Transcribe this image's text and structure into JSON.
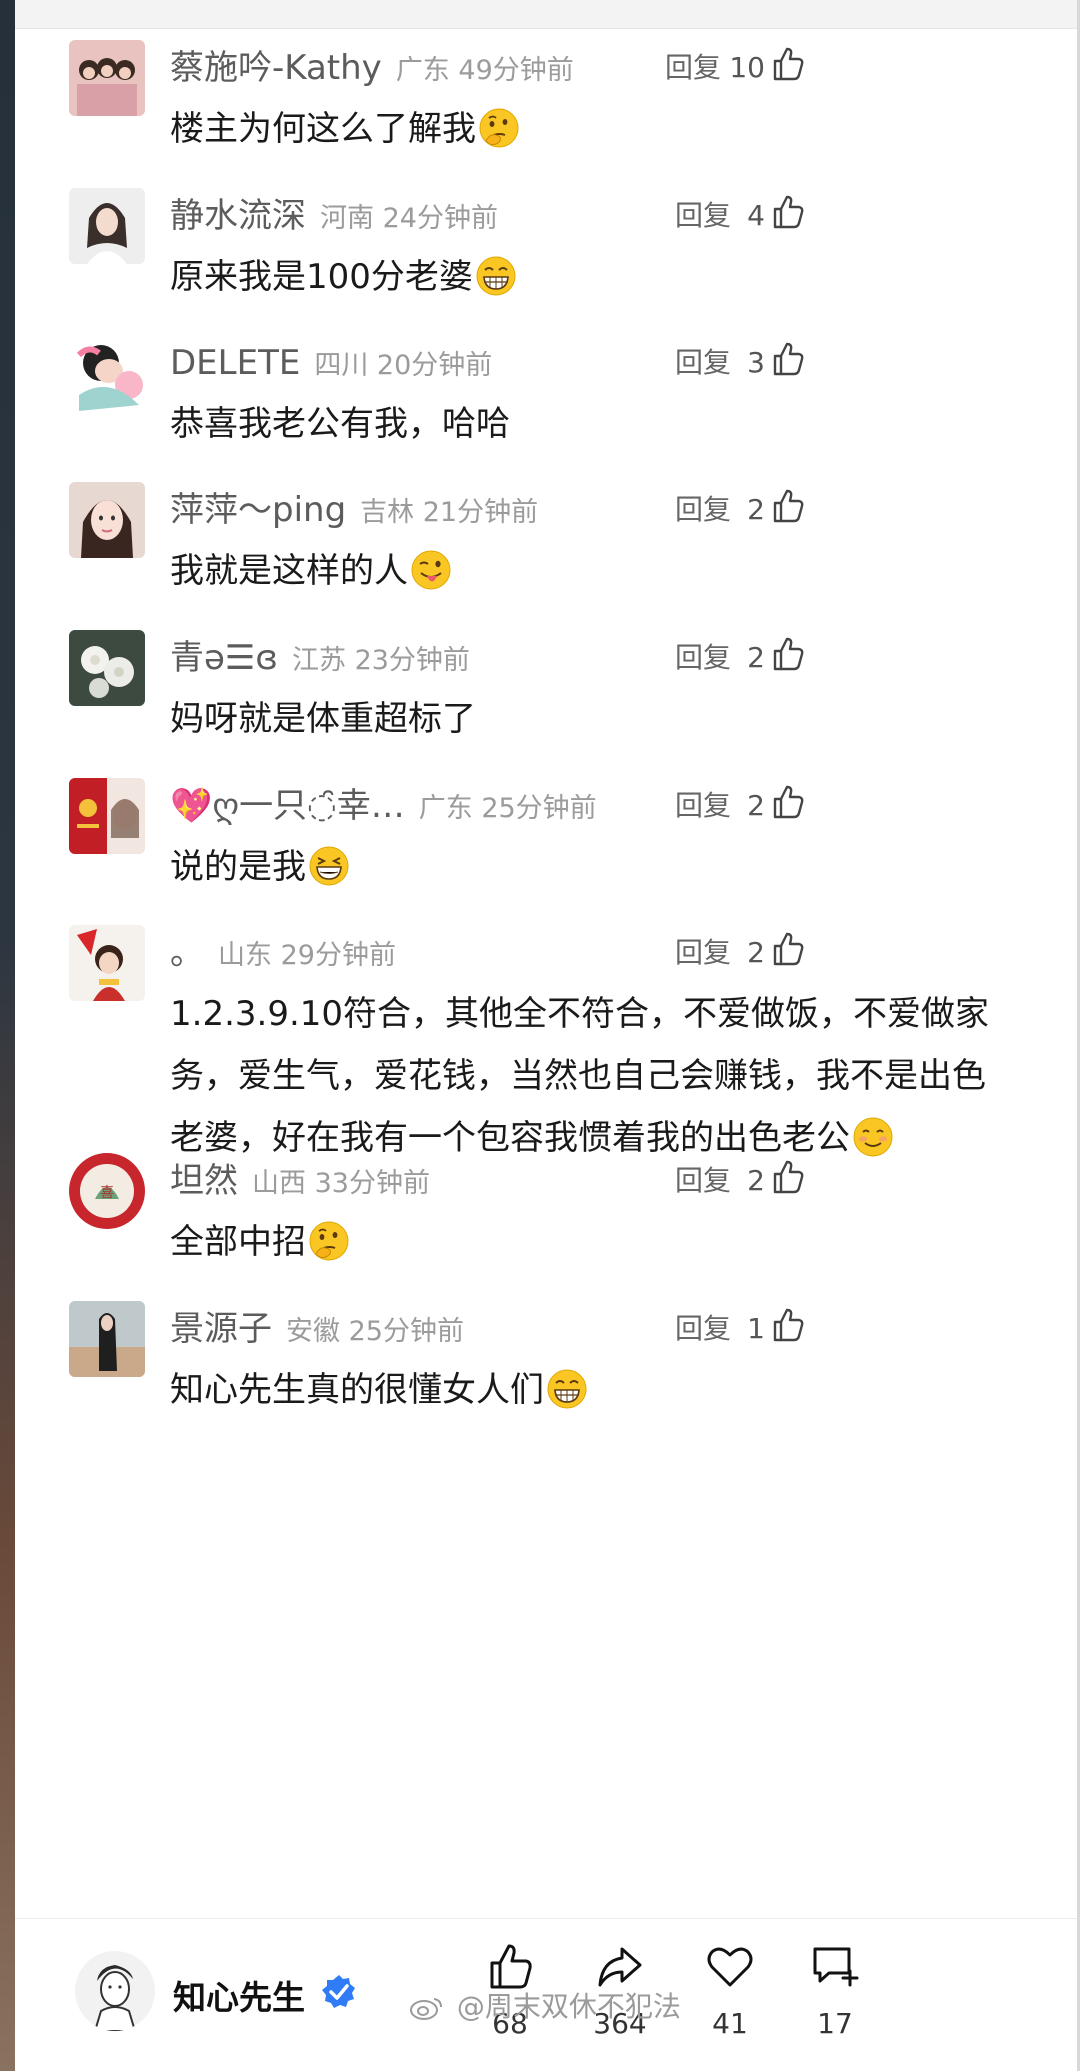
{
  "reply_label": "回复",
  "comments": [
    {
      "username": "蔡施吟-Kathy",
      "location_time": "广东 49分钟前",
      "likes": "10",
      "text": "楼主为何这么了解我",
      "emoji": "thinking-face-emoji"
    },
    {
      "username": "静水流深",
      "location_time": "河南 24分钟前",
      "likes": "4",
      "text": "原来我是100分老婆",
      "emoji": "grinning-face-emoji"
    },
    {
      "username": "DELETE",
      "location_time": "四川 20分钟前",
      "likes": "3",
      "text": "恭喜我老公有我，哈哈",
      "emoji": ""
    },
    {
      "username": "萍萍～ping",
      "location_time": "吉林 21分钟前",
      "likes": "2",
      "text": "我就是这样的人",
      "emoji": "winking-tongue-face-emoji"
    },
    {
      "username": "青ə☰ɞ",
      "location_time": "江苏 23分钟前",
      "likes": "2",
      "text": "妈呀就是体重超标了",
      "emoji": ""
    },
    {
      "username": "💖ღ一只◌̑幸…",
      "location_time": "广东 25分钟前",
      "likes": "2",
      "text": "说的是我",
      "emoji": "grinning-squint-face-emoji"
    },
    {
      "username": "。",
      "location_time": "山东 29分钟前",
      "likes": "2",
      "text_lines": [
        "1.2.3.9.10符合，其他全不符合，不爱做饭，不爱做家",
        "务，爱生气，爱花钱，当然也自己会赚钱，我不是出色",
        "老婆，好在我有一个包容我惯着我的出色老公"
      ],
      "emoji": "smiling-face-emoji"
    },
    {
      "username": "坦然",
      "location_time": "山西 33分钟前",
      "likes": "2",
      "text": "全部中招",
      "emoji": "thinking-face-emoji"
    },
    {
      "username": "景源子",
      "location_time": "安徽 25分钟前",
      "likes": "1",
      "text": "知心先生真的很懂女人们",
      "emoji": "grinning-face-emoji"
    }
  ],
  "author": {
    "name": "知心先生",
    "verified": true
  },
  "actions": [
    {
      "icon": "thumbs-up-icon",
      "count": "68"
    },
    {
      "icon": "share-icon",
      "count": "364"
    },
    {
      "icon": "heart-icon",
      "count": "41"
    },
    {
      "icon": "comment-add-icon",
      "count": "17"
    }
  ],
  "watermark": "@周末双休不犯法",
  "colors": {
    "verified": "#2f7cf6",
    "emoji_yellow": "#f9c623"
  }
}
